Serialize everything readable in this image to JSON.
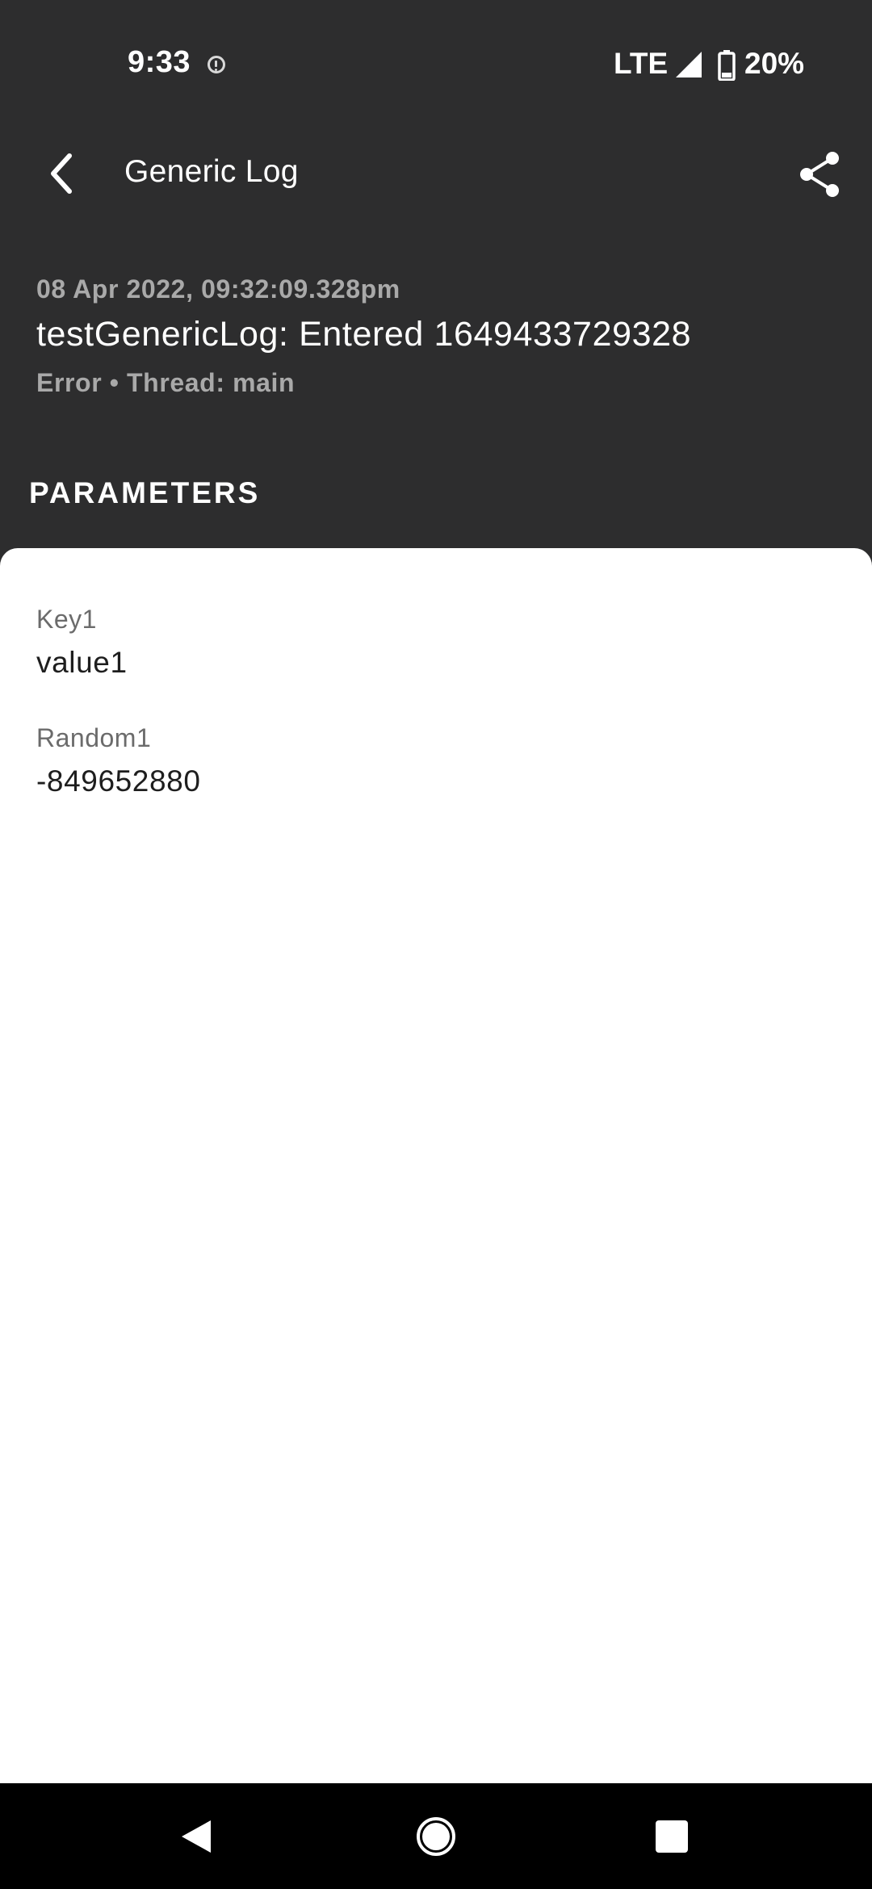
{
  "status_bar": {
    "time": "9:33",
    "network": "LTE",
    "battery": "20%",
    "icons": [
      "alert-icon",
      "signal-icon",
      "battery-icon"
    ]
  },
  "toolbar": {
    "title": "Generic Log",
    "back_icon": "chevron-left-icon",
    "share_icon": "share-icon"
  },
  "log": {
    "timestamp": "08 Apr 2022, 09:32:09.328pm",
    "message": "testGenericLog: Entered 1649433729328",
    "meta": "Error • Thread: main"
  },
  "parameters": {
    "heading": "PARAMETERS",
    "items": [
      {
        "key": "Key1",
        "value": "value1"
      },
      {
        "key": "Random1",
        "value": "-849652880"
      }
    ]
  },
  "nav_bar": {
    "icons": [
      "nav-back-icon",
      "nav-home-icon",
      "nav-recents-icon"
    ]
  },
  "colors": {
    "background_dark": "#2d2d2e",
    "sheet": "#ffffff",
    "nav_bar": "#000000",
    "secondary_text": "#a9a9a9"
  }
}
